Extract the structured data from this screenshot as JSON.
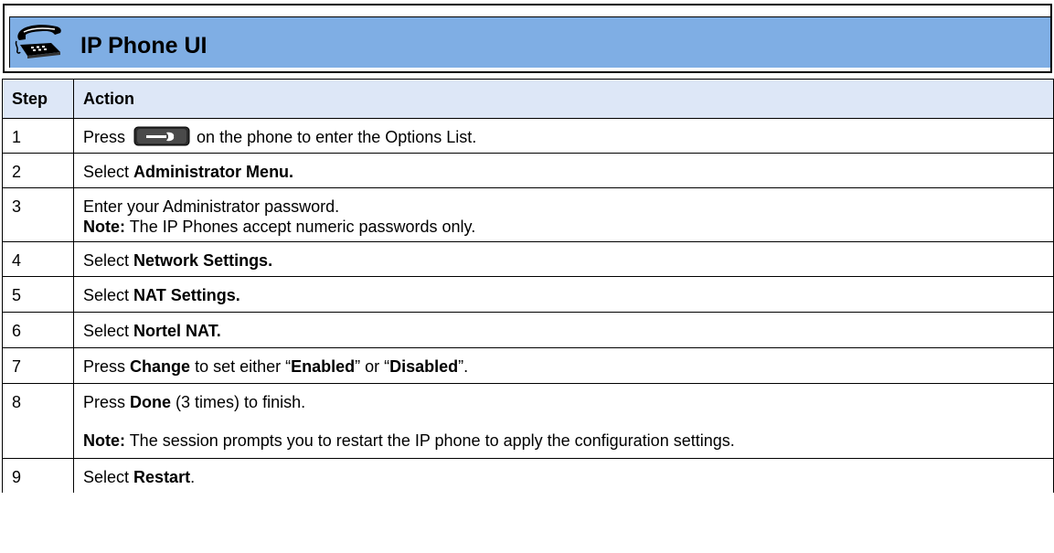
{
  "header": {
    "title": "IP Phone UI",
    "icon": "desk-phone-icon"
  },
  "table": {
    "columns": [
      "Step",
      "Action"
    ],
    "rows": [
      {
        "step": "1",
        "press": "Press",
        "options_key_icon": "options-key-icon",
        "rest": "on the phone to enter the Options List."
      },
      {
        "step": "2",
        "pre": "Select",
        "bold": "Administrator Menu."
      },
      {
        "step": "3",
        "line1": "Enter your Administrator password.",
        "note_label": "Note:",
        "note_text": "The IP Phones accept numeric passwords only."
      },
      {
        "step": "4",
        "pre": "Select",
        "bold": "Network Settings."
      },
      {
        "step": "5",
        "pre": "Select",
        "bold": "NAT Settings."
      },
      {
        "step": "6",
        "pre": "Select",
        "bold": "Nortel NAT."
      },
      {
        "step": "7",
        "pre": "Press",
        "bold1": "Change",
        "mid1": "to set either “",
        "bold2": "Enabled",
        "mid2": "” or “",
        "bold3": "Disabled",
        "post": "”."
      },
      {
        "step": "8",
        "pre": "Press",
        "bold": "Done",
        "post": "(3 times) to finish.",
        "note_label": "Note:",
        "note_text": "The session prompts you to restart the IP phone to apply the configuration settings."
      },
      {
        "step": "9",
        "pre": "Select",
        "bold": "Restart",
        "post": "."
      }
    ]
  },
  "colors": {
    "header_bar": "#7faee4",
    "table_header": "#dde7f7",
    "border": "#000000"
  }
}
